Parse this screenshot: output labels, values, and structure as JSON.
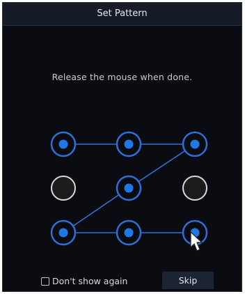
{
  "dialog": {
    "title": "Set Pattern",
    "instruction": "Release the mouse when done."
  },
  "pattern": {
    "active_color": "#1f78e6",
    "ring_color": "#2f6fd6",
    "inactive_ring_color": "#d9d9d9",
    "inactive_fill_color": "#1c1c1c",
    "grid_rows": 3,
    "grid_cols": 3,
    "selected_nodes": [
      1,
      2,
      3,
      5,
      7,
      8,
      9
    ],
    "drawn_sequence": [
      1,
      2,
      3,
      5,
      7,
      8,
      9
    ]
  },
  "footer": {
    "dont_show_label": "Don't show again",
    "dont_show_checked": false,
    "skip_label": "Skip"
  },
  "icons": {
    "cursor": "mouse-pointer-icon",
    "checkbox": "checkbox-icon"
  }
}
